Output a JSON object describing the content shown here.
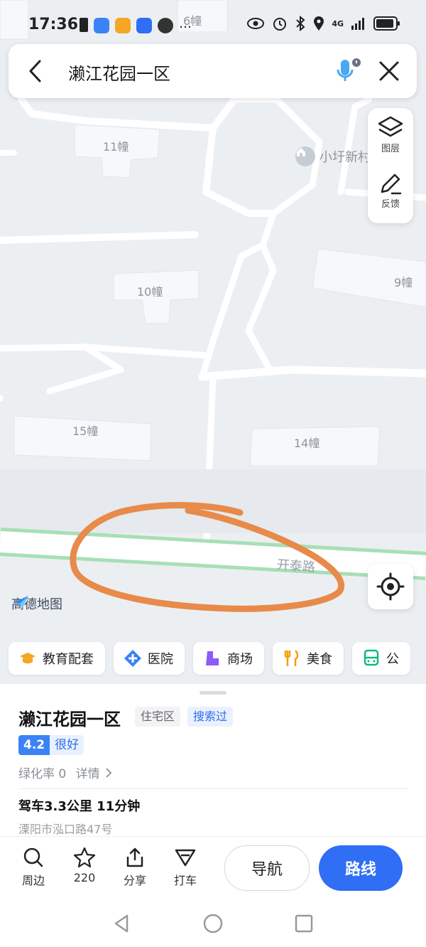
{
  "status_bar": {
    "time": "17:36",
    "network": "4G",
    "icons": [
      "sim-alert-icon",
      "message-icon",
      "app-icon",
      "app-icon",
      "app-icon",
      "more-dots-icon",
      "eye-icon",
      "alarm-icon",
      "bluetooth-icon",
      "location-icon",
      "signal-icon",
      "battery-icon"
    ]
  },
  "search": {
    "title": "濑江花园一区"
  },
  "map": {
    "buildings": [
      "6幢",
      "11幢",
      "10幢",
      "9幢",
      "15幢",
      "14幢"
    ],
    "poi": "小圩新村",
    "road": "开泰路",
    "logo": "高德地图"
  },
  "side_panel": {
    "layers_label": "图层",
    "feedback_label": "反馈"
  },
  "categories": [
    {
      "label": "教育配套",
      "icon": "graduation-cap-icon",
      "color": "#f5a623"
    },
    {
      "label": "医院",
      "icon": "hospital-cross-icon",
      "color": "#3b82f6"
    },
    {
      "label": "商场",
      "icon": "mall-icon",
      "color": "#8b5cf6"
    },
    {
      "label": "美食",
      "icon": "utensils-icon",
      "color": "#f59e0b"
    },
    {
      "label": "公",
      "icon": "bus-icon",
      "color": "#10b981"
    }
  ],
  "place": {
    "name": "濑江花园一区",
    "type_tag": "住宅区",
    "searched_tag": "搜索过",
    "score": "4.2",
    "score_word": "很好",
    "greening": "绿化率 0",
    "details_link": "详情",
    "drive_info": "驾车3.3公里 11分钟",
    "address": "溧阳市泓口路47号"
  },
  "toolbar": {
    "nearby": "周边",
    "favorites_count": "220",
    "share": "分享",
    "taxi": "打车",
    "navigate": "导航",
    "route": "路线"
  },
  "colors": {
    "accent": "#2f6ef5",
    "annotation": "#e88a4a",
    "road_green": "#a8dfb6"
  }
}
